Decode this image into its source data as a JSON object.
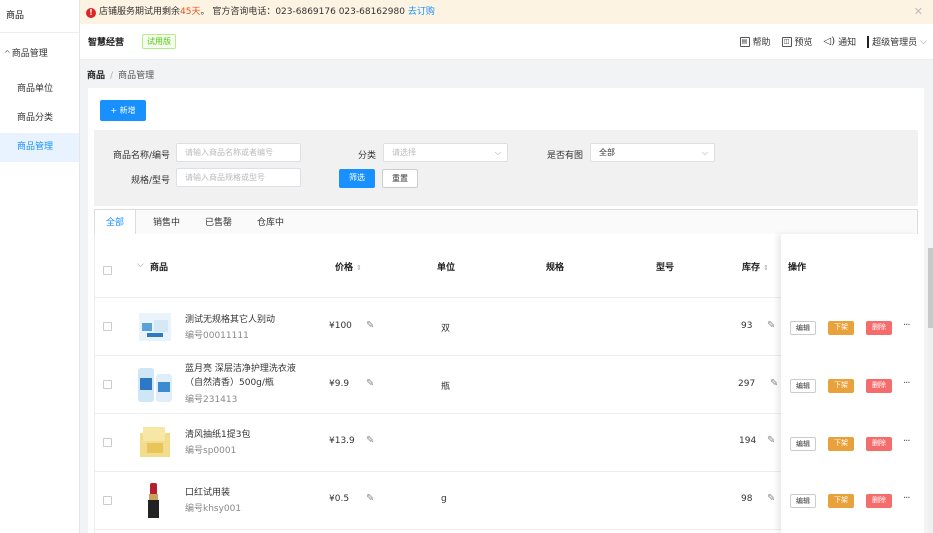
{
  "sidebar": {
    "title": "商品",
    "group": "商品管理",
    "items": [
      {
        "label": "商品单位",
        "active": false
      },
      {
        "label": "商品分类",
        "active": false
      },
      {
        "label": "商品管理",
        "active": true
      }
    ]
  },
  "notice": {
    "prefix": "店铺服务期试用剩余",
    "days": "45天",
    "suffix": "。 官方咨询电话：023-6869176 023-68162980",
    "buy_link": "去订购"
  },
  "header": {
    "brand": "智慧经营",
    "badge": "试用版",
    "help": "帮助",
    "preview": "预览",
    "notify": "通知",
    "user": "超级管理员"
  },
  "breadcrumb": {
    "root": "商品",
    "current": "商品管理"
  },
  "toolbar": {
    "add_label": "+ 新增"
  },
  "filter": {
    "name_label": "商品名称/编号",
    "name_placeholder": "请输入商品名称或者编号",
    "category_label": "分类",
    "category_placeholder": "请选择",
    "has_image_label": "是否有图",
    "has_image_value": "全部",
    "spec_label": "规格/型号",
    "spec_placeholder": "请输入商品规格或型号",
    "search_button": "筛选",
    "reset_button": "重置"
  },
  "tabs": [
    "全部",
    "销售中",
    "已售罄",
    "仓库中"
  ],
  "table": {
    "columns": {
      "product": "商品",
      "price": "价格",
      "unit": "单位",
      "spec": "规格",
      "model": "型号",
      "stock": "库存",
      "ops": "操作"
    },
    "actions": {
      "edit": "编辑",
      "offline": "下架",
      "delete": "删除",
      "more": "···"
    },
    "rows": [
      {
        "name": "测试无规格其它人别动",
        "code": "编号00011111",
        "price": "¥100",
        "unit": "双",
        "stock": "93"
      },
      {
        "name": "蓝月亮 深层洁净护理洗衣液（自然清香）500g/瓶",
        "code": "编号231413",
        "price": "¥9.9",
        "unit": "瓶",
        "stock": "297"
      },
      {
        "name": "清风抽纸1提3包",
        "code": "编号sp0001",
        "price": "¥13.9",
        "unit": "",
        "stock": "194"
      },
      {
        "name": "口红试用装",
        "code": "编号khsy001",
        "price": "¥0.5",
        "unit": "g",
        "stock": "98"
      }
    ]
  },
  "colors": {
    "primary": "#1890ff",
    "warning": "#e9a23b",
    "danger": "#f56c6c",
    "notice_bg": "#fdf3e3"
  }
}
